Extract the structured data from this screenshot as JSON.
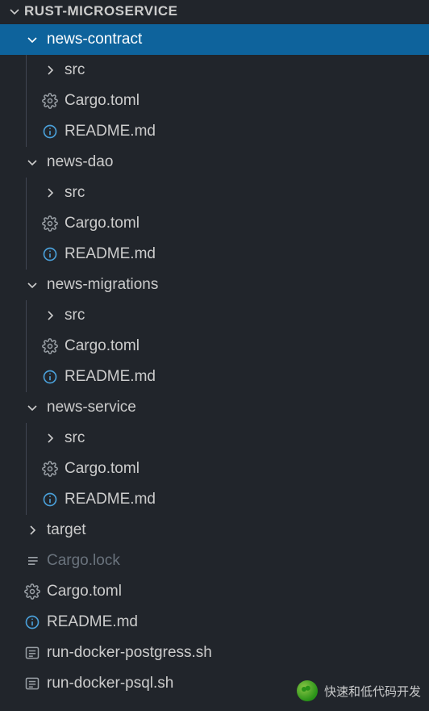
{
  "header": {
    "title": "RUST-MICROSERVICE"
  },
  "watermark": {
    "text": "快速和低代码开发"
  },
  "tree": [
    {
      "depth": 0,
      "kind": "folder",
      "expanded": true,
      "label": "news-contract",
      "selected": true
    },
    {
      "depth": 1,
      "kind": "folder",
      "expanded": false,
      "label": "src"
    },
    {
      "depth": 1,
      "kind": "file",
      "icon": "gear",
      "label": "Cargo.toml"
    },
    {
      "depth": 1,
      "kind": "file",
      "icon": "info",
      "label": "README.md"
    },
    {
      "depth": 0,
      "kind": "folder",
      "expanded": true,
      "label": "news-dao"
    },
    {
      "depth": 1,
      "kind": "folder",
      "expanded": false,
      "label": "src"
    },
    {
      "depth": 1,
      "kind": "file",
      "icon": "gear",
      "label": "Cargo.toml"
    },
    {
      "depth": 1,
      "kind": "file",
      "icon": "info",
      "label": "README.md"
    },
    {
      "depth": 0,
      "kind": "folder",
      "expanded": true,
      "label": "news-migrations"
    },
    {
      "depth": 1,
      "kind": "folder",
      "expanded": false,
      "label": "src"
    },
    {
      "depth": 1,
      "kind": "file",
      "icon": "gear",
      "label": "Cargo.toml"
    },
    {
      "depth": 1,
      "kind": "file",
      "icon": "info",
      "label": "README.md"
    },
    {
      "depth": 0,
      "kind": "folder",
      "expanded": true,
      "label": "news-service"
    },
    {
      "depth": 1,
      "kind": "folder",
      "expanded": false,
      "label": "src"
    },
    {
      "depth": 1,
      "kind": "file",
      "icon": "gear",
      "label": "Cargo.toml"
    },
    {
      "depth": 1,
      "kind": "file",
      "icon": "info",
      "label": "README.md"
    },
    {
      "depth": 0,
      "kind": "folder",
      "expanded": false,
      "label": "target"
    },
    {
      "depth": 0,
      "kind": "file",
      "icon": "list",
      "label": "Cargo.lock",
      "dim": true
    },
    {
      "depth": 0,
      "kind": "file",
      "icon": "gear",
      "label": "Cargo.toml"
    },
    {
      "depth": 0,
      "kind": "file",
      "icon": "info",
      "label": "README.md"
    },
    {
      "depth": 0,
      "kind": "file",
      "icon": "sh",
      "label": "run-docker-postgress.sh"
    },
    {
      "depth": 0,
      "kind": "file",
      "icon": "sh",
      "label": "run-docker-psql.sh"
    }
  ]
}
